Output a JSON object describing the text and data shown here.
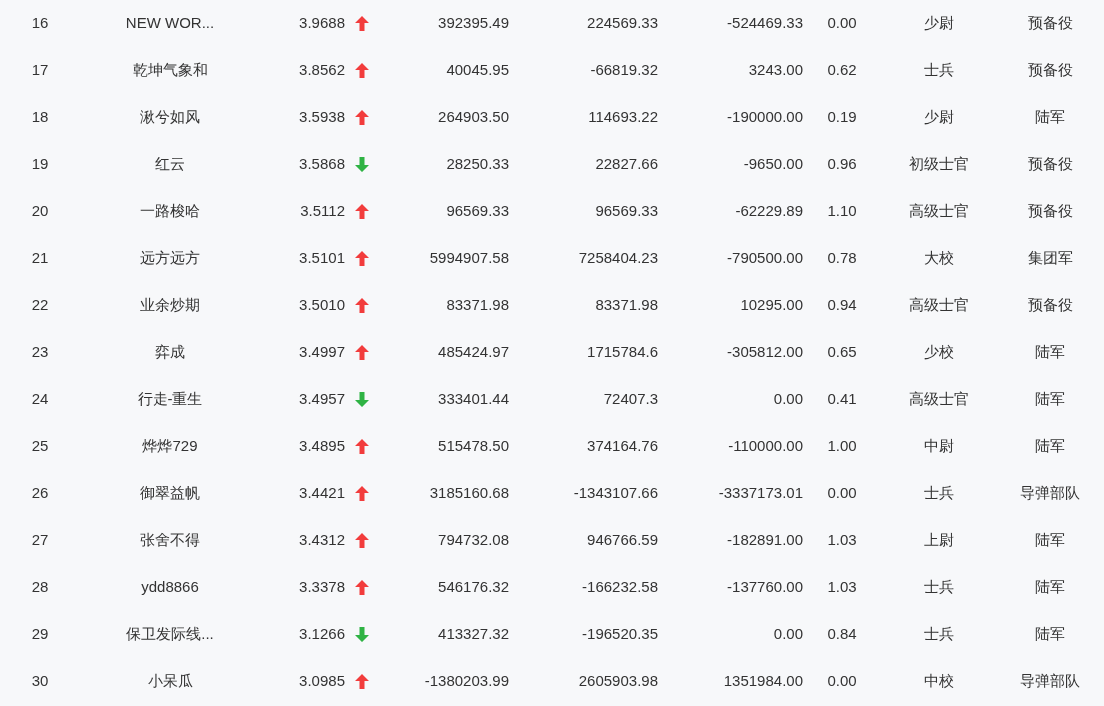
{
  "table": {
    "rows": [
      {
        "rising": true,
        "cells": [
          "16",
          "NEW WOR...",
          "3.9688",
          "392395.49",
          "224569.33",
          "-524469.33",
          "0.00",
          "少尉",
          "预备役"
        ]
      },
      {
        "rising": true,
        "cells": [
          "17",
          "乾坤气象和",
          "3.8562",
          "40045.95",
          "-66819.32",
          "3243.00",
          "0.62",
          "士兵",
          "预备役"
        ]
      },
      {
        "rising": true,
        "cells": [
          "18",
          "湫兮如风",
          "3.5938",
          "264903.50",
          "114693.22",
          "-190000.00",
          "0.19",
          "少尉",
          "陆军"
        ]
      },
      {
        "rising": false,
        "cells": [
          "19",
          "红云",
          "3.5868",
          "28250.33",
          "22827.66",
          "-9650.00",
          "0.96",
          "初级士官",
          "预备役"
        ]
      },
      {
        "rising": true,
        "cells": [
          "20",
          "一路梭哈",
          "3.5112",
          "96569.33",
          "96569.33",
          "-62229.89",
          "1.10",
          "高级士官",
          "预备役"
        ]
      },
      {
        "rising": true,
        "cells": [
          "21",
          "远方远方",
          "3.5101",
          "5994907.58",
          "7258404.23",
          "-790500.00",
          "0.78",
          "大校",
          "集团军"
        ]
      },
      {
        "rising": true,
        "cells": [
          "22",
          "业余炒期",
          "3.5010",
          "83371.98",
          "83371.98",
          "10295.00",
          "0.94",
          "高级士官",
          "预备役"
        ]
      },
      {
        "rising": true,
        "cells": [
          "23",
          "弈成",
          "3.4997",
          "485424.97",
          "1715784.6",
          "-305812.00",
          "0.65",
          "少校",
          "陆军"
        ]
      },
      {
        "rising": false,
        "cells": [
          "24",
          "行走-重生",
          "3.4957",
          "333401.44",
          "72407.3",
          "0.00",
          "0.41",
          "高级士官",
          "陆军"
        ]
      },
      {
        "rising": true,
        "cells": [
          "25",
          "烨烨729",
          "3.4895",
          "515478.50",
          "374164.76",
          "-110000.00",
          "1.00",
          "中尉",
          "陆军"
        ]
      },
      {
        "rising": true,
        "cells": [
          "26",
          "御翠益帆",
          "3.4421",
          "3185160.68",
          "-1343107.66",
          "-3337173.01",
          "0.00",
          "士兵",
          "导弹部队"
        ]
      },
      {
        "rising": true,
        "cells": [
          "27",
          "张舍不得",
          "3.4312",
          "794732.08",
          "946766.59",
          "-182891.00",
          "1.03",
          "上尉",
          "陆军"
        ]
      },
      {
        "rising": true,
        "cells": [
          "28",
          "ydd8866",
          "3.3378",
          "546176.32",
          "-166232.58",
          "-137760.00",
          "1.03",
          "士兵",
          "陆军"
        ]
      },
      {
        "rising": false,
        "cells": [
          "29",
          "保卫发际线...",
          "3.1266",
          "413327.32",
          "-196520.35",
          "0.00",
          "0.84",
          "士兵",
          "陆军"
        ]
      },
      {
        "rising": true,
        "cells": [
          "30",
          "小呆瓜",
          "3.0985",
          "-1380203.99",
          "2605903.98",
          "1351984.00",
          "0.00",
          "中校",
          "导弹部队"
        ]
      }
    ]
  }
}
